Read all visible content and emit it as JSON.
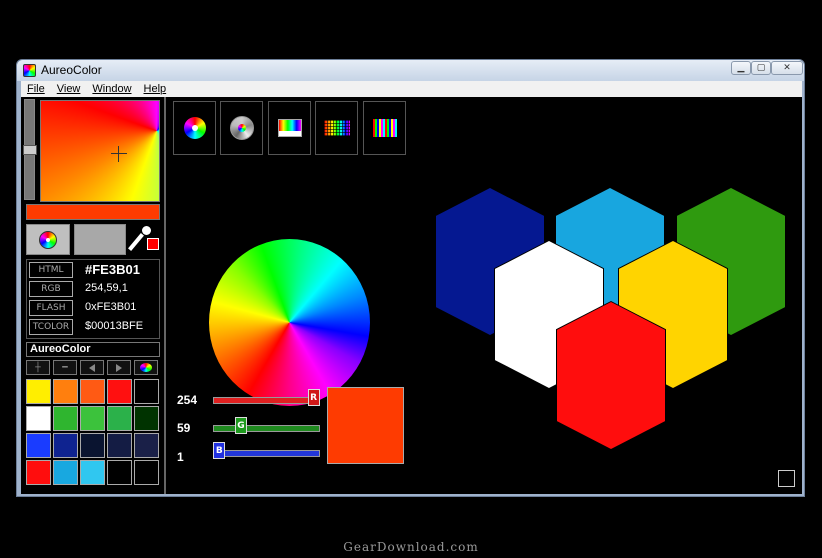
{
  "window": {
    "title": "AureoColor"
  },
  "menu": [
    "File",
    "View",
    "Window",
    "Help"
  ],
  "current_color": "#FE3B01",
  "codes": [
    {
      "label": "HTML",
      "value": "#FE3B01"
    },
    {
      "label": "RGB",
      "value": "254,59,1"
    },
    {
      "label": "FLASH",
      "value": "0xFE3B01"
    },
    {
      "label": "TCOLOR",
      "value": "$00013BFE"
    }
  ],
  "palette": {
    "title": "AureoColor",
    "colors": [
      "#ffee00",
      "#ff7f0e",
      "#ff5a14",
      "#ff1010",
      "#000000",
      "#ffffff",
      "#2fb52f",
      "#3cc23c",
      "#2bb14a",
      "#003300",
      "#1a3cff",
      "#0f2390",
      "#0a1430",
      "#141c44",
      "#1a2048",
      "#ff0d0d",
      "#18a8e0",
      "#30c7f0",
      "#000000",
      "#000000"
    ]
  },
  "sliders": [
    {
      "name": "R",
      "value": 254,
      "max": 255,
      "color": "#e02020",
      "thumb": "#d01818"
    },
    {
      "name": "G",
      "value": 59,
      "max": 255,
      "color": "#1f8a1f",
      "thumb": "#1e9a1e"
    },
    {
      "name": "B",
      "value": 1,
      "max": 255,
      "color": "#2236d8",
      "thumb": "#2030e0"
    }
  ],
  "hexagons": [
    {
      "name": "blue",
      "color": "#051891"
    },
    {
      "name": "sky",
      "color": "#18a6df"
    },
    {
      "name": "green",
      "color": "#2f9a0f"
    },
    {
      "name": "white",
      "color": "#ffffff"
    },
    {
      "name": "yellow",
      "color": "#ffd400"
    },
    {
      "name": "red",
      "color": "#ff0d0d"
    }
  ],
  "watermark": "GearDownload.com"
}
